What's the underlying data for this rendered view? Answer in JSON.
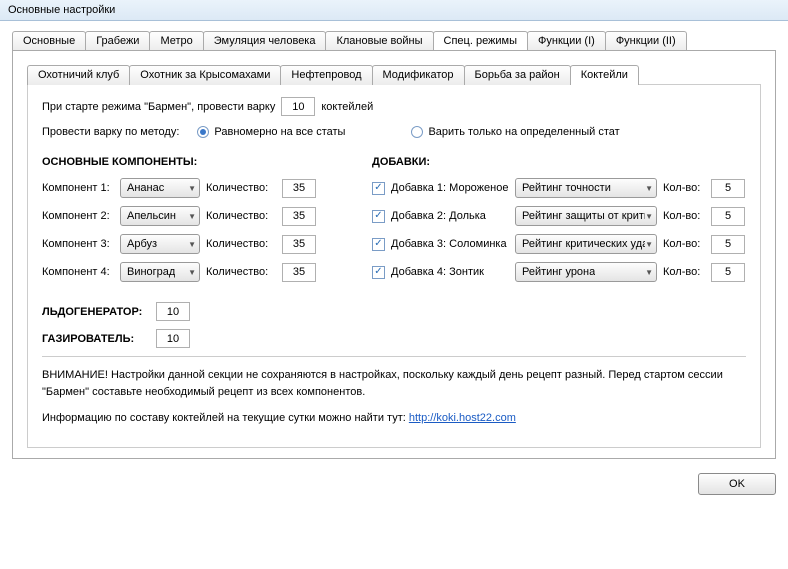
{
  "window": {
    "title": "Основные настройки"
  },
  "tabs_outer": {
    "items": [
      {
        "label": "Основные"
      },
      {
        "label": "Грабежи"
      },
      {
        "label": "Метро"
      },
      {
        "label": "Эмуляция человека"
      },
      {
        "label": "Клановые войны"
      },
      {
        "label": "Спец. режимы",
        "active": true
      },
      {
        "label": "Функции (I)"
      },
      {
        "label": "Функции (II)"
      }
    ]
  },
  "tabs_inner": {
    "items": [
      {
        "label": "Охотничий клуб"
      },
      {
        "label": "Охотник за Крысомахами"
      },
      {
        "label": "Нефтепровод"
      },
      {
        "label": "Модификатор"
      },
      {
        "label": "Борьба за район"
      },
      {
        "label": "Коктейли",
        "active": true
      }
    ]
  },
  "start": {
    "pre": "При старте режима \"Бармен\", провести варку",
    "value": "10",
    "post": "коктейлей"
  },
  "method": {
    "label": "Провести варку по методу:",
    "opt1": "Равномерно на все статы",
    "opt2": "Варить только на определенный стат",
    "selected": 0
  },
  "sections": {
    "components": "ОСНОВНЫЕ КОМПОНЕНТЫ:",
    "additions": "ДОБАВКИ:",
    "ice": "ЛЬДОГЕНЕРАТОР:",
    "gas": "ГАЗИРОВАТЕЛЬ:"
  },
  "components": [
    {
      "lbl": "Компонент 1:",
      "name": "Ананас",
      "qlbl": "Количество:",
      "q": "35"
    },
    {
      "lbl": "Компонент 2:",
      "name": "Апельсин",
      "qlbl": "Количество:",
      "q": "35"
    },
    {
      "lbl": "Компонент 3:",
      "name": "Арбуз",
      "qlbl": "Количество:",
      "q": "35"
    },
    {
      "lbl": "Компонент 4:",
      "name": "Виноград",
      "qlbl": "Количество:",
      "q": "35"
    }
  ],
  "additions": [
    {
      "chk": true,
      "lbl": "Добавка 1: Мороженое",
      "rating": "Рейтинг точности",
      "qlbl": "Кол-во:",
      "q": "5"
    },
    {
      "chk": true,
      "lbl": "Добавка 2: Долька",
      "rating": "Рейтинг защиты от крити",
      "qlbl": "Кол-во:",
      "q": "5"
    },
    {
      "chk": true,
      "lbl": "Добавка 3: Соломинка",
      "rating": "Рейтинг критических уда",
      "qlbl": "Кол-во:",
      "q": "5"
    },
    {
      "chk": true,
      "lbl": "Добавка 4: Зонтик",
      "rating": "Рейтинг урона",
      "qlbl": "Кол-во:",
      "q": "5"
    }
  ],
  "ice_value": "10",
  "gas_value": "10",
  "warning": "ВНИМАНИЕ! Настройки данной секции не сохраняются в настройках, поскольку каждый день рецепт разный. Перед стартом сессии \"Бармен\"  составьте необходимый рецепт из всех компонентов.",
  "info_pre": "Информацию по составу коктейлей на текущие сутки можно найти тут: ",
  "info_link": "http://koki.host22.com",
  "ok_label": "OK"
}
